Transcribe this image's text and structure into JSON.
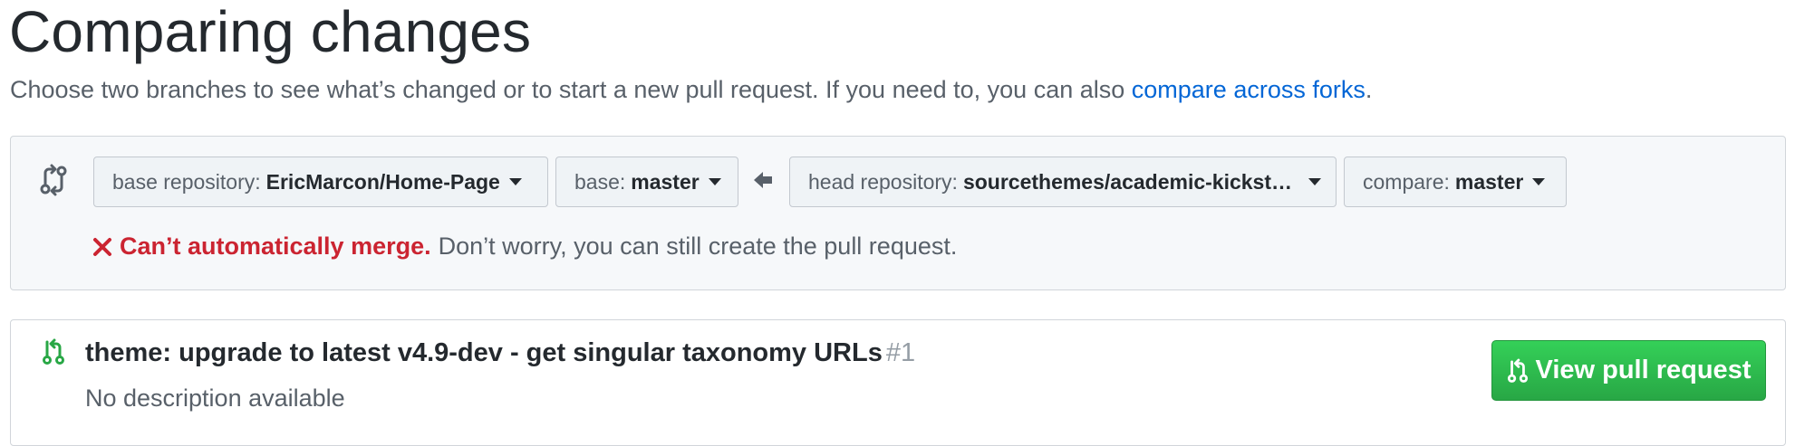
{
  "header": {
    "title": "Comparing changes",
    "subtitle_text": "Choose two branches to see what’s changed or to start a new pull request. If you need to, you can also ",
    "subtitle_link": "compare across forks",
    "subtitle_end": "."
  },
  "range": {
    "compare_icon": "git-compare-icon",
    "base_repo": {
      "label": "base repository:",
      "value": "EricMarcon/Home-Page"
    },
    "base_branch": {
      "label": "base:",
      "value": "master"
    },
    "arrow_icon": "arrow-left-icon",
    "head_repo": {
      "label": "head repository:",
      "value": "sourcethemes/academic-kickst…"
    },
    "compare_branch": {
      "label": "compare:",
      "value": "master"
    },
    "merge_status": {
      "icon": "x-icon",
      "status": "Can’t automatically merge.",
      "message": "Don’t worry, you can still create the pull request."
    }
  },
  "pull_request": {
    "icon": "git-pull-request-icon",
    "title": "theme: upgrade to latest v4.9-dev - get singular taxonomy URLs",
    "number": "#1",
    "description": "No description available",
    "view_button": "View pull request"
  },
  "colors": {
    "link": "#0366d6",
    "error": "#cb2431",
    "success": "#28a745",
    "pr_icon": "#28a745"
  }
}
